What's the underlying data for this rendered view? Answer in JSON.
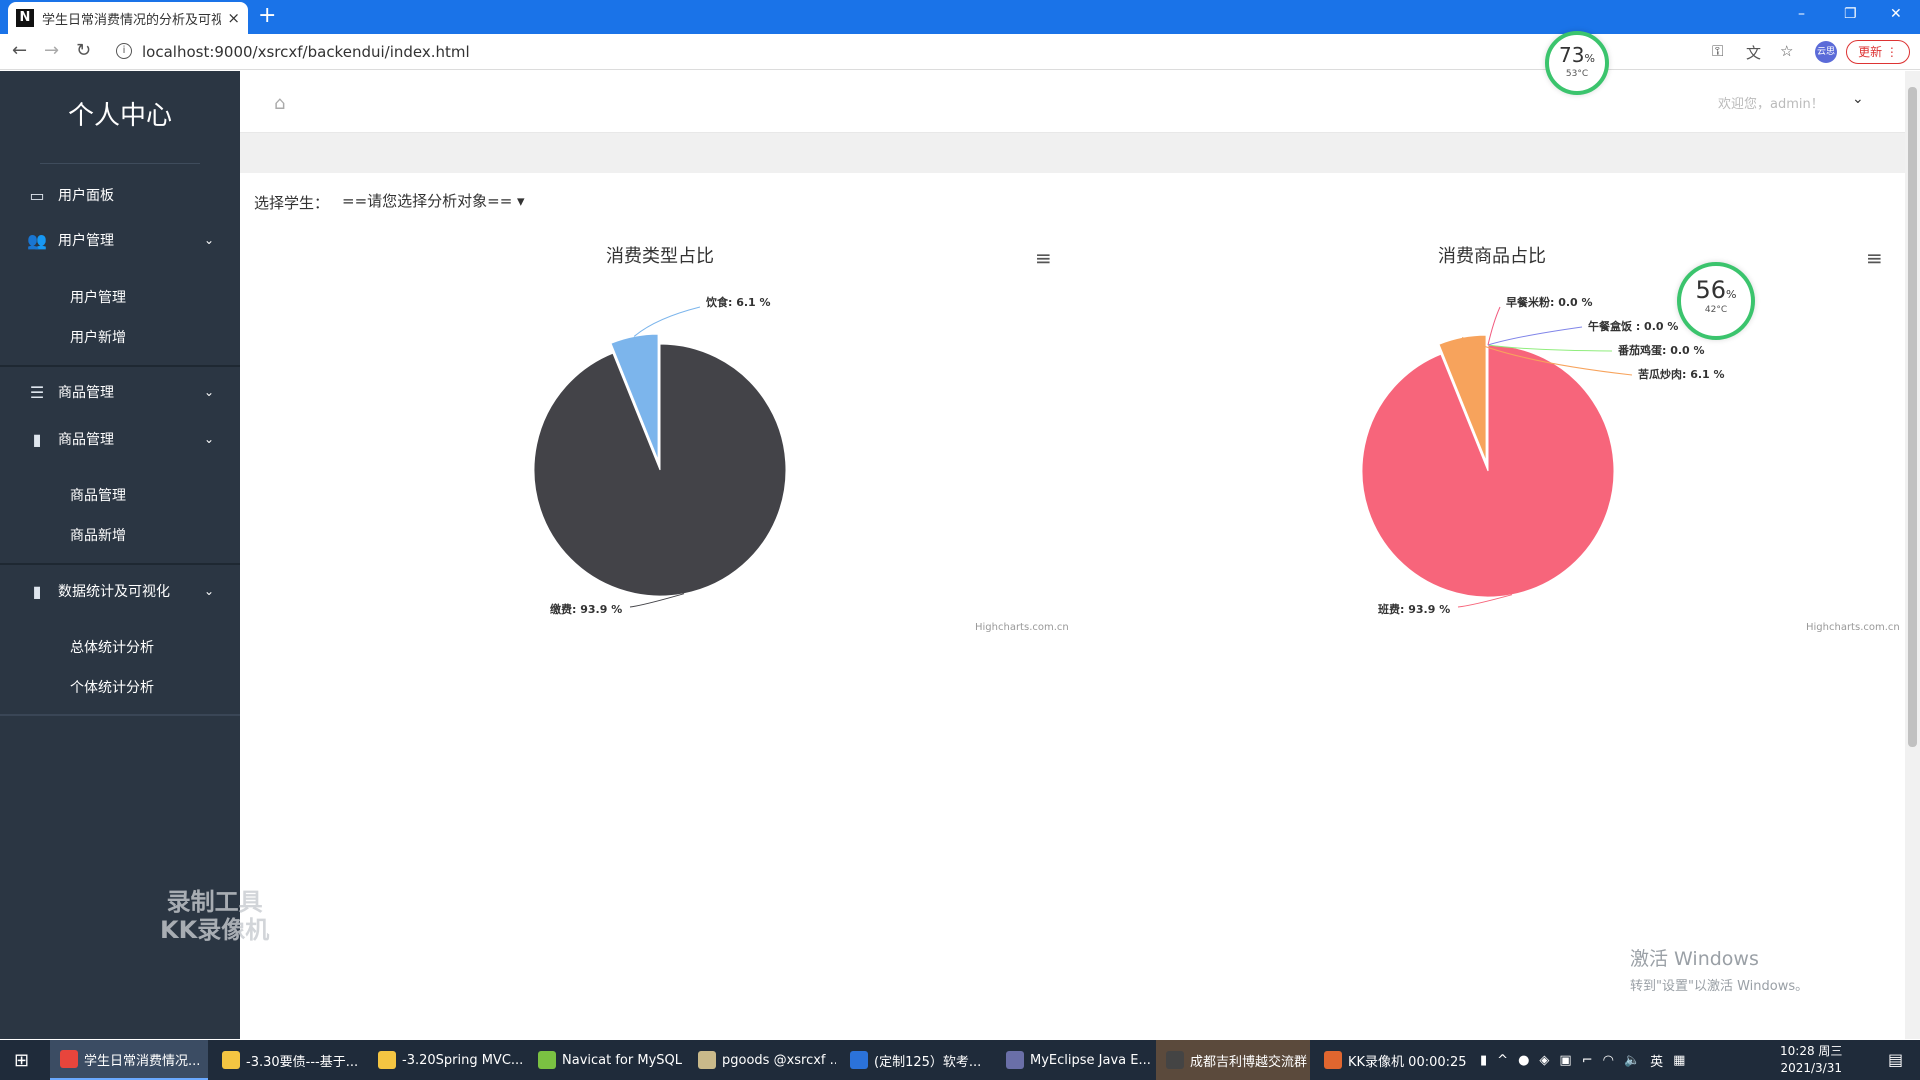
{
  "browser": {
    "tab_favicon": "N",
    "tab_title": "学生日常消费情况的分析及可视化",
    "tab_close": "×",
    "new_tab": "+",
    "url": "localhost:9000/xsrcxf/backendui/index.html",
    "update_button": "更新",
    "profile_badge": "云思",
    "window_minimize": "–",
    "window_restore": "❐",
    "window_close": "✕"
  },
  "overlays": {
    "gauge_top": {
      "percent": "73",
      "unit": "%",
      "temp": "53°C"
    },
    "gauge_chart": {
      "percent": "56",
      "unit": "%",
      "temp": "42°C"
    },
    "watermark_line1": "录制工具",
    "watermark_line2": "KK录像机",
    "activate_title": "激活 Windows",
    "activate_subtitle": "转到\"设置\"以激活 Windows。"
  },
  "sidebar": {
    "title": "个人中心",
    "items": [
      {
        "label": "用户面板",
        "icon": "laptop-icon"
      },
      {
        "label": "用户管理",
        "icon": "users-icon"
      },
      {
        "label": "商品管理",
        "icon": "list-icon"
      },
      {
        "label": "商品管理",
        "icon": "file-icon"
      },
      {
        "label": "数据统计及可视化",
        "icon": "file-icon"
      }
    ],
    "sub_user": [
      "用户管理",
      "用户新增"
    ],
    "sub_goods": [
      "商品管理",
      "商品新增"
    ],
    "sub_stats": [
      "总体统计分析",
      "个体统计分析"
    ]
  },
  "header": {
    "welcome": "欢迎您，admin！"
  },
  "filter": {
    "label": "选择学生：",
    "selected": "==请您选择分析对象=="
  },
  "chart_data": [
    {
      "type": "pie",
      "title": "消费类型占比",
      "credits": "Highcharts.com.cn",
      "slices": [
        {
          "name": "缴费",
          "value": 93.9,
          "label": "缴费: 93.9 %",
          "color": "#434348"
        },
        {
          "name": "饮食",
          "value": 6.1,
          "label": "饮食: 6.1 %",
          "color": "#7cb5ec",
          "sliced": true
        }
      ]
    },
    {
      "type": "pie",
      "title": "消费商品占比",
      "credits": "Highcharts.com.cn",
      "slices": [
        {
          "name": "班费",
          "value": 93.9,
          "label": "班费: 93.9 %",
          "color": "#f7657b"
        },
        {
          "name": "苦瓜炒肉",
          "value": 6.1,
          "label": "苦瓜炒肉: 6.1 %",
          "color": "#f7a35c",
          "sliced": true
        },
        {
          "name": "番茄鸡蛋",
          "value": 0.0,
          "label": "番茄鸡蛋: 0.0 %",
          "color": "#90ed7d"
        },
        {
          "name": "午餐盒饭",
          "value": 0.0,
          "label": "午餐盒饭 : 0.0 %",
          "color": "#8085e9"
        },
        {
          "name": "早餐米粉",
          "value": 0.0,
          "label": "早餐米粉: 0.0 %",
          "color": "#f15c80"
        }
      ]
    }
  ],
  "taskbar": {
    "items": [
      {
        "label": "学生日常消费情况...",
        "icon": "chrome-icon",
        "color": "#e8453c"
      },
      {
        "label": "-3.30要债---基于...",
        "icon": "folder-icon",
        "color": "#f4c542"
      },
      {
        "label": "-3.20Spring MVC...",
        "icon": "folder-icon",
        "color": "#f4c542"
      },
      {
        "label": "Navicat for MySQL",
        "icon": "navicat-icon",
        "color": "#7ac142"
      },
      {
        "label": "pgoods @xsrcxf ...",
        "icon": "table-icon",
        "color": "#c9b98a"
      },
      {
        "label": "(定制125）软考...",
        "icon": "word-icon",
        "color": "#2b72d9"
      },
      {
        "label": "MyEclipse Java E...",
        "icon": "eclipse-icon",
        "color": "#6a6fa8"
      },
      {
        "label": "成都吉利博越交流群",
        "icon": "chat-icon",
        "color": "#444"
      },
      {
        "label": "KK录像机 00:00:25",
        "icon": "recorder-icon",
        "color": "#e0662f"
      }
    ],
    "ime": "英",
    "clock_time": "10:28 周三",
    "clock_date": "2021/3/31"
  }
}
